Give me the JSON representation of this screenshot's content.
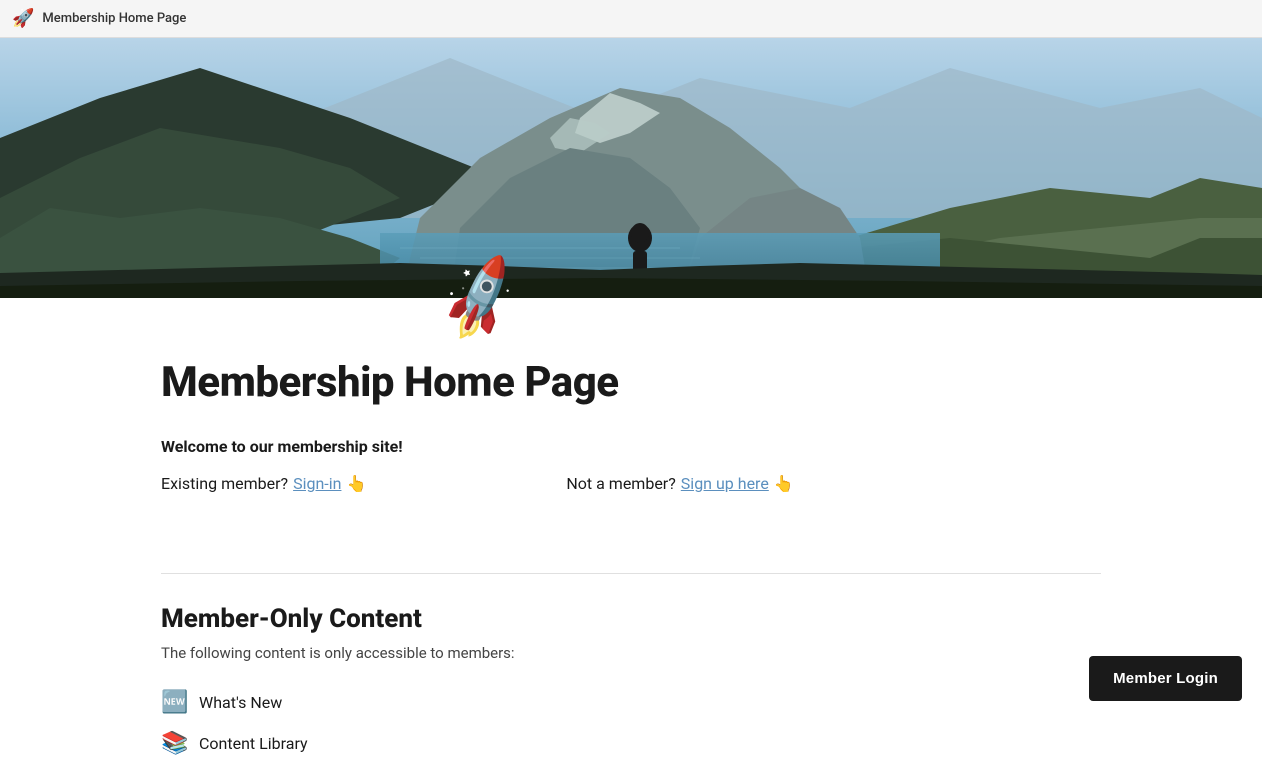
{
  "browser": {
    "icon": "🚀",
    "title": "Membership Home Page"
  },
  "hero": {
    "alt": "Mountain lake landscape"
  },
  "rocket_emoji": "🚀",
  "page": {
    "title": "Membership Home Page",
    "welcome_text": "Welcome to our membership site!",
    "existing_member_label": "Existing member?",
    "signin_link": "Sign-in",
    "signin_emoji": "👆",
    "not_member_label": "Not a member?",
    "signup_link": "Sign up here",
    "signup_emoji": "👆"
  },
  "member_only": {
    "section_title": "Member-Only Content",
    "description": "The following content is only accessible to members:",
    "items": [
      {
        "icon": "🆕",
        "label": "What's New",
        "icon_alt": "new-badge-icon"
      },
      {
        "icon": "📚",
        "label": "Content Library",
        "icon_alt": "books-icon"
      }
    ]
  },
  "footer": {
    "login_button": "Member Login"
  }
}
